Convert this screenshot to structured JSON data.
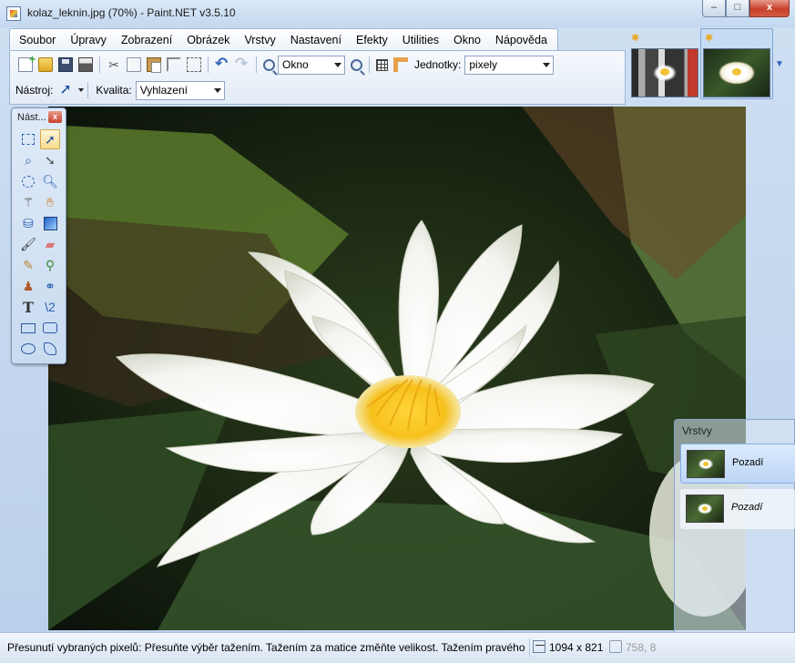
{
  "window": {
    "title": "kolaz_leknin.jpg (70%) - Paint.NET v3.5.10",
    "minimize_label": "–",
    "maximize_label": "□",
    "close_label": "x"
  },
  "menu": {
    "items": [
      {
        "label": "Soubor"
      },
      {
        "label": "Úpravy"
      },
      {
        "label": "Zobrazení"
      },
      {
        "label": "Obrázek"
      },
      {
        "label": "Vrstvy"
      },
      {
        "label": "Nastavení"
      },
      {
        "label": "Efekty"
      },
      {
        "label": "Utilities"
      },
      {
        "label": "Okno"
      },
      {
        "label": "Nápověda"
      }
    ]
  },
  "toolbar": {
    "zoom_value": "Okno",
    "units_label": "Jednotky:",
    "units_value": "pixely",
    "tool_label": "Nástroj:",
    "quality_label": "Kvalita:",
    "quality_value": "Vyhlazení"
  },
  "tools_window": {
    "title": "Nást...",
    "close_label": "x",
    "text_tool_glyph": "T",
    "text_tool_glyph_alt": "\\2"
  },
  "layers_window": {
    "title": "Vrstvy",
    "layers": [
      {
        "name": "Pozadí",
        "selected": true
      },
      {
        "name": "Pozadí",
        "selected": false
      }
    ]
  },
  "status": {
    "text": "Přesunutí vybraných pixelů: Přesuňte výběr tažením. Tažením za matice změňte velikost. Tažením pravého tl",
    "image_size": "1094 x 821",
    "extra": "758, 8"
  },
  "colors": {
    "accent": "#2d63b8",
    "close_red": "#c7402c",
    "thumbnail_star": "#e8a61a"
  }
}
